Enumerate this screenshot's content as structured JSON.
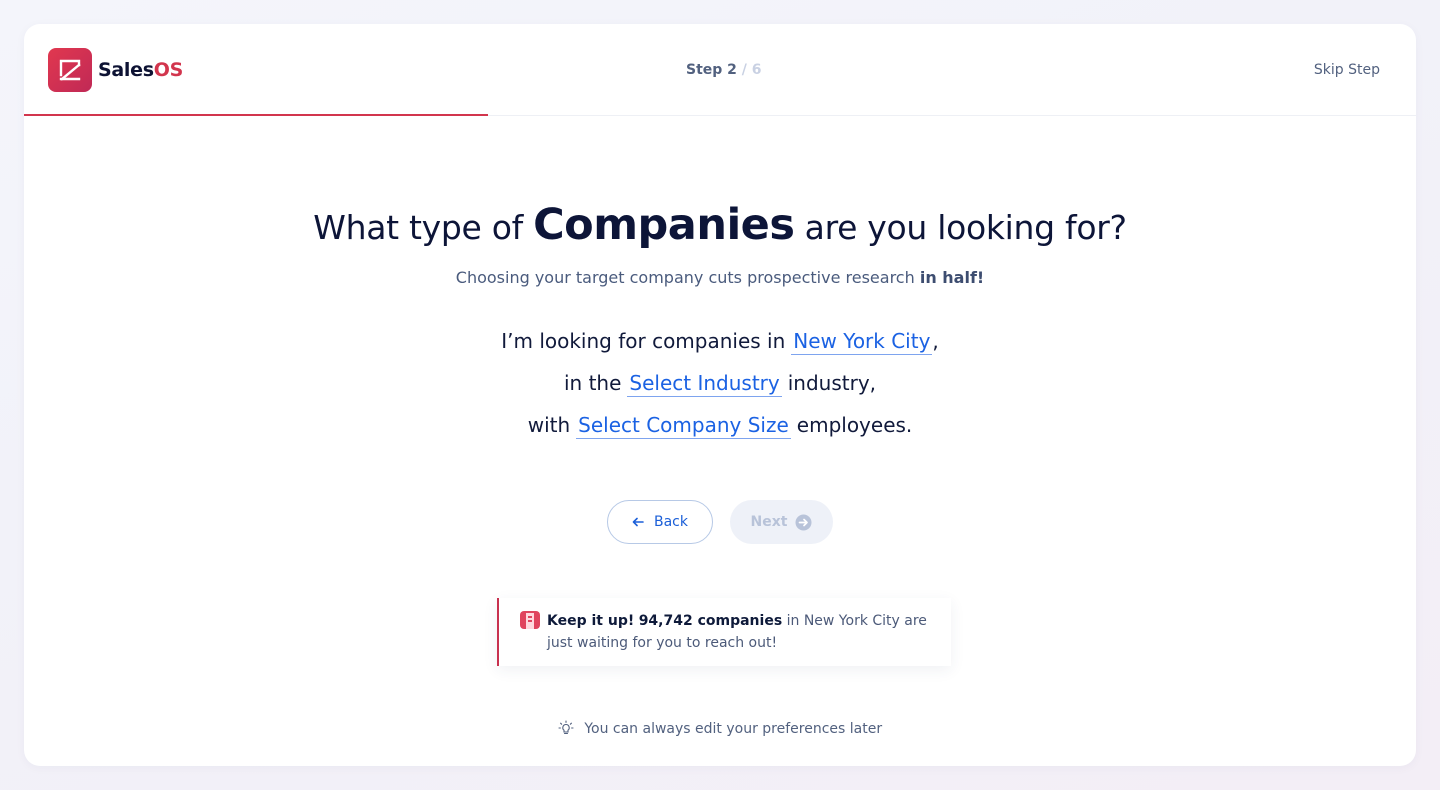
{
  "brand": {
    "name_part1": "Sales",
    "name_part2": "OS",
    "accent": "#d2354d"
  },
  "header": {
    "step_current": "Step 2",
    "step_separator": "/",
    "step_total": "6",
    "skip_label": "Skip Step",
    "progress_fraction": 0.333
  },
  "main": {
    "title_prefix": "What type of",
    "title_emphasis": "Companies",
    "title_suffix": "are you looking for?",
    "subtitle_text": "Choosing your target company cuts prospective research",
    "subtitle_bold": "in half!",
    "line1_prefix": "I’m looking for companies in",
    "location_value": "New York City",
    "line1_suffix": ",",
    "line2_prefix": "in the",
    "industry_placeholder": "Select Industry",
    "line2_suffix": "industry,",
    "line3_prefix": "with",
    "company_size_placeholder": "Select Company Size",
    "line3_suffix": "employees."
  },
  "buttons": {
    "back_label": "Back",
    "next_label": "Next"
  },
  "notice": {
    "lead": "Keep it up!",
    "count": "94,742 companies",
    "rest": "in New York City are just waiting for you to reach out!"
  },
  "tip": {
    "text": "You can always edit your preferences later",
    "icon": "lightbulb-icon"
  }
}
